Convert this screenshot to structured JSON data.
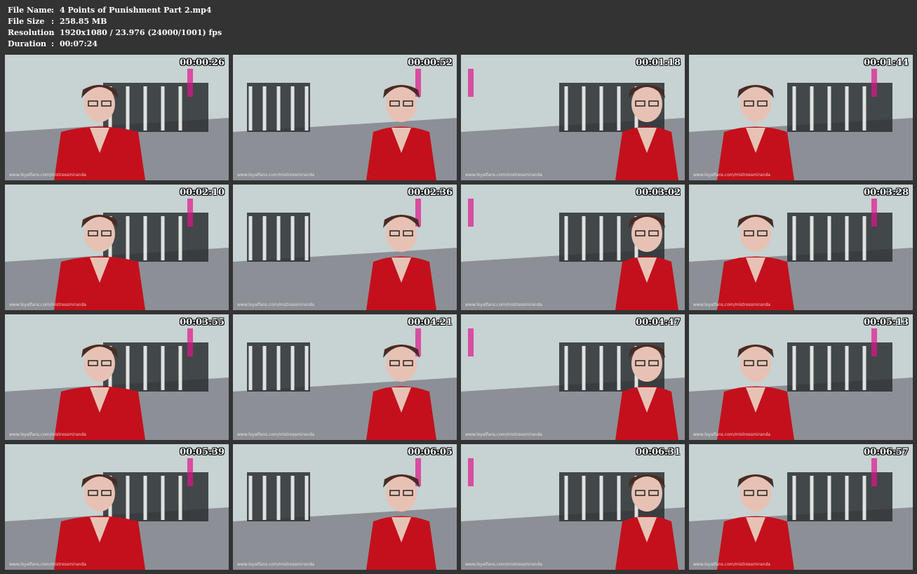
{
  "file_info": [
    {
      "label": "File Name",
      "sep": ":",
      "value": "4 Points of Punishment Part 2.mp4"
    },
    {
      "label": "File Size",
      "sep": ":",
      "value": "258.85 MB"
    },
    {
      "label": "Resolution",
      "sep": ":",
      "value": "1920x1080 / 23.976 (24000/1001) fps"
    },
    {
      "label": "Duration",
      "sep": ":",
      "value": "00:07:24"
    }
  ],
  "thumbnails": [
    {
      "timestamp": "00:00:26",
      "watermark": "www.loyalfans.com/mistressmiranda"
    },
    {
      "timestamp": "00:00:52",
      "watermark": "www.loyalfans.com/mistressmiranda"
    },
    {
      "timestamp": "00:01:18",
      "watermark": "www.loyalfans.com/mistressmiranda"
    },
    {
      "timestamp": "00:01:44",
      "watermark": "www.loyalfans.com/mistressmiranda"
    },
    {
      "timestamp": "00:02:10",
      "watermark": "www.loyalfans.com/mistressmiranda"
    },
    {
      "timestamp": "00:02:36",
      "watermark": "www.loyalfans.com/mistressmiranda"
    },
    {
      "timestamp": "00:03:02",
      "watermark": "www.loyalfans.com/mistressmiranda"
    },
    {
      "timestamp": "00:03:28",
      "watermark": "www.loyalfans.com/mistressmiranda"
    },
    {
      "timestamp": "00:03:55",
      "watermark": "www.loyalfans.com/mistressmiranda"
    },
    {
      "timestamp": "00:04:21",
      "watermark": "www.loyalfans.com/mistressmiranda"
    },
    {
      "timestamp": "00:04:47",
      "watermark": "www.loyalfans.com/mistressmiranda"
    },
    {
      "timestamp": "00:05:13",
      "watermark": "www.loyalfans.com/mistressmiranda"
    },
    {
      "timestamp": "00:05:39",
      "watermark": "www.loyalfans.com/mistressmiranda"
    },
    {
      "timestamp": "00:06:05",
      "watermark": "www.loyalfans.com/mistressmiranda"
    },
    {
      "timestamp": "00:06:31",
      "watermark": "www.loyalfans.com/mistressmiranda"
    },
    {
      "timestamp": "00:06:57",
      "watermark": "www.loyalfans.com/mistressmiranda"
    }
  ],
  "colors": {
    "background": "#333333",
    "text": "#ffffff",
    "frame_wall": "#c7d2d2",
    "frame_floor": "#8d8f96",
    "accent_red": "#c4101c",
    "accent_pink": "#e0148c"
  }
}
